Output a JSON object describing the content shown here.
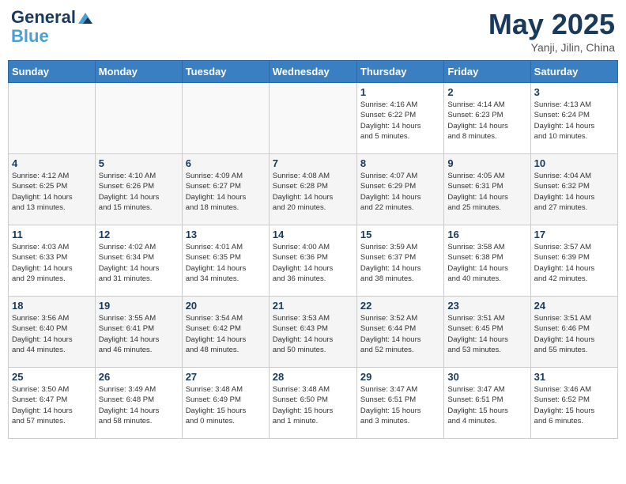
{
  "header": {
    "logo_line1": "General",
    "logo_line2": "Blue",
    "month": "May 2025",
    "location": "Yanji, Jilin, China"
  },
  "days_of_week": [
    "Sunday",
    "Monday",
    "Tuesday",
    "Wednesday",
    "Thursday",
    "Friday",
    "Saturday"
  ],
  "weeks": [
    [
      {
        "day": "",
        "info": ""
      },
      {
        "day": "",
        "info": ""
      },
      {
        "day": "",
        "info": ""
      },
      {
        "day": "",
        "info": ""
      },
      {
        "day": "1",
        "info": "Sunrise: 4:16 AM\nSunset: 6:22 PM\nDaylight: 14 hours\nand 5 minutes."
      },
      {
        "day": "2",
        "info": "Sunrise: 4:14 AM\nSunset: 6:23 PM\nDaylight: 14 hours\nand 8 minutes."
      },
      {
        "day": "3",
        "info": "Sunrise: 4:13 AM\nSunset: 6:24 PM\nDaylight: 14 hours\nand 10 minutes."
      }
    ],
    [
      {
        "day": "4",
        "info": "Sunrise: 4:12 AM\nSunset: 6:25 PM\nDaylight: 14 hours\nand 13 minutes."
      },
      {
        "day": "5",
        "info": "Sunrise: 4:10 AM\nSunset: 6:26 PM\nDaylight: 14 hours\nand 15 minutes."
      },
      {
        "day": "6",
        "info": "Sunrise: 4:09 AM\nSunset: 6:27 PM\nDaylight: 14 hours\nand 18 minutes."
      },
      {
        "day": "7",
        "info": "Sunrise: 4:08 AM\nSunset: 6:28 PM\nDaylight: 14 hours\nand 20 minutes."
      },
      {
        "day": "8",
        "info": "Sunrise: 4:07 AM\nSunset: 6:29 PM\nDaylight: 14 hours\nand 22 minutes."
      },
      {
        "day": "9",
        "info": "Sunrise: 4:05 AM\nSunset: 6:31 PM\nDaylight: 14 hours\nand 25 minutes."
      },
      {
        "day": "10",
        "info": "Sunrise: 4:04 AM\nSunset: 6:32 PM\nDaylight: 14 hours\nand 27 minutes."
      }
    ],
    [
      {
        "day": "11",
        "info": "Sunrise: 4:03 AM\nSunset: 6:33 PM\nDaylight: 14 hours\nand 29 minutes."
      },
      {
        "day": "12",
        "info": "Sunrise: 4:02 AM\nSunset: 6:34 PM\nDaylight: 14 hours\nand 31 minutes."
      },
      {
        "day": "13",
        "info": "Sunrise: 4:01 AM\nSunset: 6:35 PM\nDaylight: 14 hours\nand 34 minutes."
      },
      {
        "day": "14",
        "info": "Sunrise: 4:00 AM\nSunset: 6:36 PM\nDaylight: 14 hours\nand 36 minutes."
      },
      {
        "day": "15",
        "info": "Sunrise: 3:59 AM\nSunset: 6:37 PM\nDaylight: 14 hours\nand 38 minutes."
      },
      {
        "day": "16",
        "info": "Sunrise: 3:58 AM\nSunset: 6:38 PM\nDaylight: 14 hours\nand 40 minutes."
      },
      {
        "day": "17",
        "info": "Sunrise: 3:57 AM\nSunset: 6:39 PM\nDaylight: 14 hours\nand 42 minutes."
      }
    ],
    [
      {
        "day": "18",
        "info": "Sunrise: 3:56 AM\nSunset: 6:40 PM\nDaylight: 14 hours\nand 44 minutes."
      },
      {
        "day": "19",
        "info": "Sunrise: 3:55 AM\nSunset: 6:41 PM\nDaylight: 14 hours\nand 46 minutes."
      },
      {
        "day": "20",
        "info": "Sunrise: 3:54 AM\nSunset: 6:42 PM\nDaylight: 14 hours\nand 48 minutes."
      },
      {
        "day": "21",
        "info": "Sunrise: 3:53 AM\nSunset: 6:43 PM\nDaylight: 14 hours\nand 50 minutes."
      },
      {
        "day": "22",
        "info": "Sunrise: 3:52 AM\nSunset: 6:44 PM\nDaylight: 14 hours\nand 52 minutes."
      },
      {
        "day": "23",
        "info": "Sunrise: 3:51 AM\nSunset: 6:45 PM\nDaylight: 14 hours\nand 53 minutes."
      },
      {
        "day": "24",
        "info": "Sunrise: 3:51 AM\nSunset: 6:46 PM\nDaylight: 14 hours\nand 55 minutes."
      }
    ],
    [
      {
        "day": "25",
        "info": "Sunrise: 3:50 AM\nSunset: 6:47 PM\nDaylight: 14 hours\nand 57 minutes."
      },
      {
        "day": "26",
        "info": "Sunrise: 3:49 AM\nSunset: 6:48 PM\nDaylight: 14 hours\nand 58 minutes."
      },
      {
        "day": "27",
        "info": "Sunrise: 3:48 AM\nSunset: 6:49 PM\nDaylight: 15 hours\nand 0 minutes."
      },
      {
        "day": "28",
        "info": "Sunrise: 3:48 AM\nSunset: 6:50 PM\nDaylight: 15 hours\nand 1 minute."
      },
      {
        "day": "29",
        "info": "Sunrise: 3:47 AM\nSunset: 6:51 PM\nDaylight: 15 hours\nand 3 minutes."
      },
      {
        "day": "30",
        "info": "Sunrise: 3:47 AM\nSunset: 6:51 PM\nDaylight: 15 hours\nand 4 minutes."
      },
      {
        "day": "31",
        "info": "Sunrise: 3:46 AM\nSunset: 6:52 PM\nDaylight: 15 hours\nand 6 minutes."
      }
    ]
  ]
}
